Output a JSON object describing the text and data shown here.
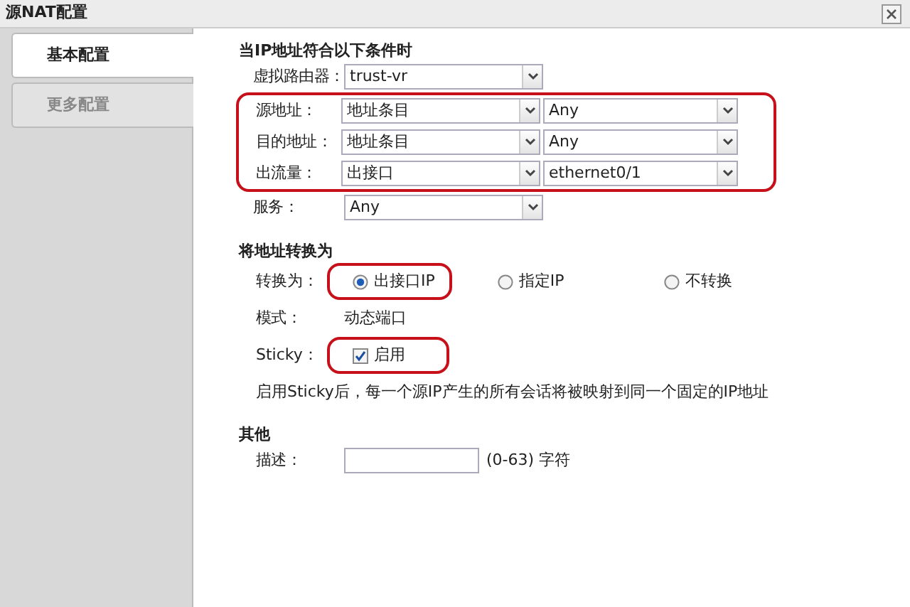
{
  "window": {
    "title": "源NAT配置"
  },
  "sidebar": [
    {
      "label": "基本配置",
      "selected": true
    },
    {
      "label": "更多配置",
      "selected": false
    }
  ],
  "conditions": {
    "heading": "当IP地址符合以下条件时",
    "rows": [
      {
        "label": "虚拟路由器：",
        "selects": [
          "trust-vr"
        ],
        "highlighted": false
      },
      {
        "label": "源地址：",
        "selects": [
          "地址条目",
          "Any"
        ],
        "highlighted": true
      },
      {
        "label": "目的地址：",
        "selects": [
          "地址条目",
          "Any"
        ],
        "highlighted": true
      },
      {
        "label": "出流量：",
        "selects": [
          "出接口",
          "ethernet0/1"
        ],
        "highlighted": true
      },
      {
        "label": "服务：",
        "selects": [
          "Any"
        ],
        "highlighted": false
      }
    ]
  },
  "translate": {
    "heading": "将地址转换为",
    "label": "转换为：",
    "options": [
      {
        "label": "出接口IP",
        "selected": true,
        "highlighted": true
      },
      {
        "label": "指定IP",
        "selected": false,
        "highlighted": false
      },
      {
        "label": "不转换",
        "selected": false,
        "highlighted": false
      }
    ],
    "mode_label": "模式：",
    "mode_value": "动态端口",
    "sticky_label": "Sticky：",
    "sticky": {
      "label": "启用",
      "checked": true,
      "highlighted": true
    },
    "note": "启用Sticky后，每一个源IP产生的所有会话将被映射到同一个固定的IP地址"
  },
  "other": {
    "heading": "其他",
    "description_label": "描述：",
    "description_hint": "(0-63) 字符"
  }
}
